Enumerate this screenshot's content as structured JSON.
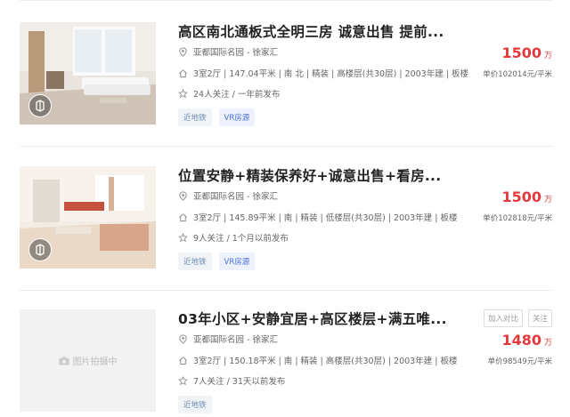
{
  "listings": [
    {
      "title": "高区南北通板式全明三房 诚意出售 提前...",
      "location": "亚都国际名园 - 徐家汇",
      "details": "3室2厅 | 147.04平米 | 南 北 | 精装 | 高楼层(共30层) | 2003年建 | 板楼",
      "followers": "24人关注 / 一年前发布",
      "tags": [
        "近地铁",
        "VR房源"
      ],
      "price_total": "1500",
      "price_unit": "万",
      "unit_price": "单价102014元/平米",
      "has_photo": true,
      "has_vr": true
    },
    {
      "title": "位置安静+精装保养好+诚意出售+看房...",
      "location": "亚都国际名园 - 徐家汇",
      "details": "3室2厅 | 145.89平米 | 南 | 精装 | 低楼层(共30层) | 2003年建 | 板楼",
      "followers": "9人关注 / 1个月以前发布",
      "tags": [
        "近地铁",
        "VR房源"
      ],
      "price_total": "1500",
      "price_unit": "万",
      "unit_price": "单价102818元/平米",
      "has_photo": true,
      "has_vr": true
    },
    {
      "title": "03年小区+安静宜居+高区楼层+满五唯...",
      "location": "亚都国际名园 - 徐家汇",
      "details": "3室2厅 | 150.18平米 | 南 | 精装 | 高楼层(共30层) | 2003年建 | 板楼",
      "followers": "7人关注 / 31天以前发布",
      "tags": [
        "近地铁"
      ],
      "price_total": "1480",
      "price_unit": "万",
      "unit_price": "单价98549元/平米",
      "has_photo": false,
      "placeholder": "图片拍摄中",
      "actions": [
        "加入对比",
        "关注"
      ]
    }
  ],
  "colors": {
    "price": "#e4393c",
    "tag_text": "#6b8cae",
    "vr_tag": "#4a6fd8"
  },
  "icons": {
    "location": "location-pin-icon",
    "details": "house-icon",
    "followers": "star-icon",
    "vr": "vr-icon",
    "camera": "camera-icon"
  }
}
